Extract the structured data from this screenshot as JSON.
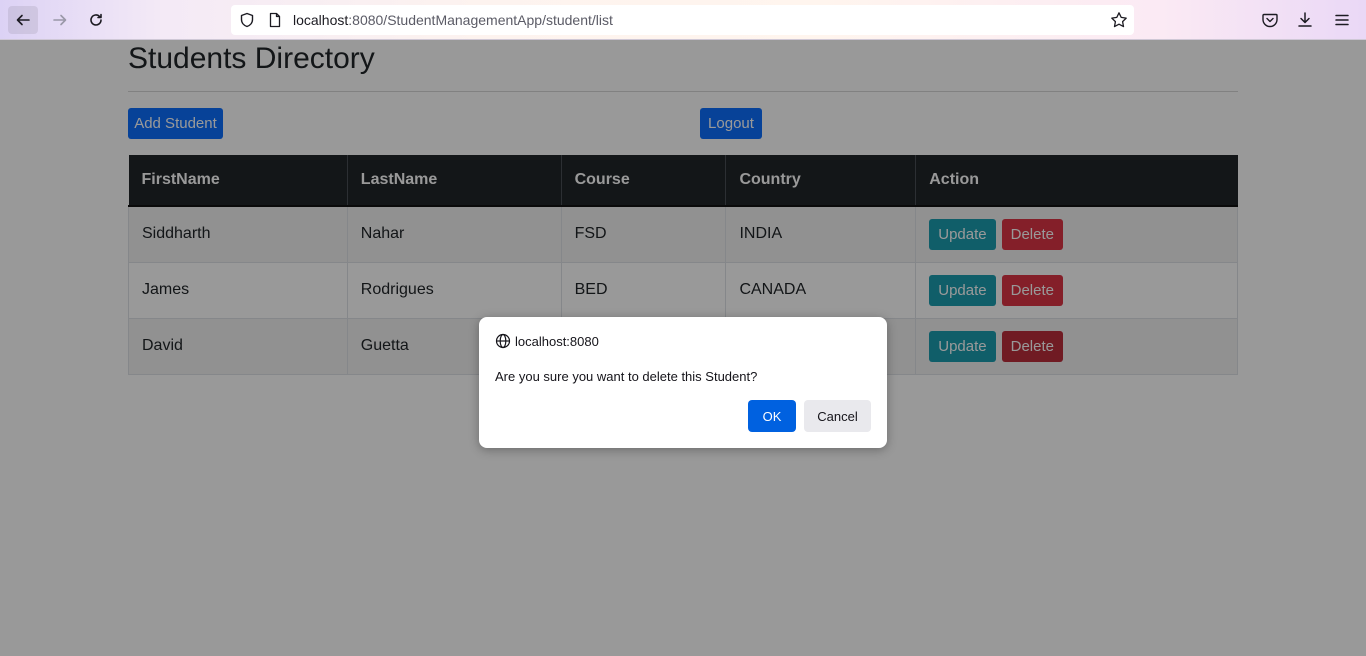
{
  "browser": {
    "url_host": "localhost",
    "url_rest": ":8080/StudentManagementApp/student/list",
    "icons": [
      "back-icon",
      "forward-icon",
      "reload-icon",
      "shield-icon",
      "page-icon",
      "star-icon",
      "pocket-icon",
      "download-icon",
      "menu-icon"
    ]
  },
  "page": {
    "title": "Students Directory",
    "add_button": "Add Student",
    "logout_button": "Logout"
  },
  "table": {
    "headers": [
      "FirstName",
      "LastName",
      "Course",
      "Country",
      "Action"
    ],
    "rows": [
      {
        "first": "Siddharth",
        "last": "Nahar",
        "course": "FSD",
        "country": "INDIA",
        "update": "Update",
        "delete": "Delete"
      },
      {
        "first": "James",
        "last": "Rodrigues",
        "course": "BED",
        "country": "CANADA",
        "update": "Update",
        "delete": "Delete"
      },
      {
        "first": "David",
        "last": "Guetta",
        "course": "",
        "country": "",
        "update": "Update",
        "delete": "Delete"
      }
    ]
  },
  "dialog": {
    "origin": "localhost:8080",
    "message": "Are you sure you want to delete this Student?",
    "ok_label": "OK",
    "cancel_label": "Cancel"
  },
  "colors": {
    "primary": "#0d6efd",
    "info": "#1b9db0",
    "danger": "#dc3545",
    "table_header": "#212529",
    "dialog_ok": "#0061e0"
  }
}
